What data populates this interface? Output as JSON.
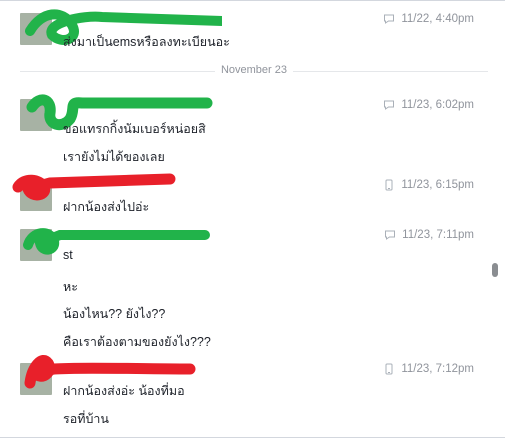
{
  "divider_label": "November 23",
  "messages": [
    {
      "time": "11/22, 4:40pm",
      "source_icon": "chat-bubble-icon",
      "lines": [
        "ส่งมาเป็นemsหรือลงทะเบียนอะ"
      ]
    },
    {
      "time": "11/23, 6:02pm",
      "source_icon": "chat-bubble-icon",
      "lines": [
        "ขอแทรกกิ้งนัมเบอร์หน่อยสิ",
        "เรายังไม่ได้ของเลย"
      ]
    },
    {
      "time": "11/23, 6:15pm",
      "source_icon": "mobile-phone-icon",
      "lines": [
        "ฝากน้องส่งไปอ่ะ"
      ]
    },
    {
      "time": "11/23, 7:11pm",
      "source_icon": "chat-bubble-icon",
      "lines": [
        "st",
        "หะ",
        "น้องไหน?? ยังไง??",
        "คือเราต้องตามของยังไง???"
      ]
    },
    {
      "time": "11/23, 7:12pm",
      "source_icon": "mobile-phone-icon",
      "lines": [
        "ฝากน้องส่งอ่ะ น้องที่มอ",
        "รอที่บ้าน"
      ]
    }
  ],
  "colors": {
    "redaction_green": "#21b34a",
    "redaction_red": "#e8202a",
    "timestamp": "#90949c",
    "text": "#1d2129"
  }
}
